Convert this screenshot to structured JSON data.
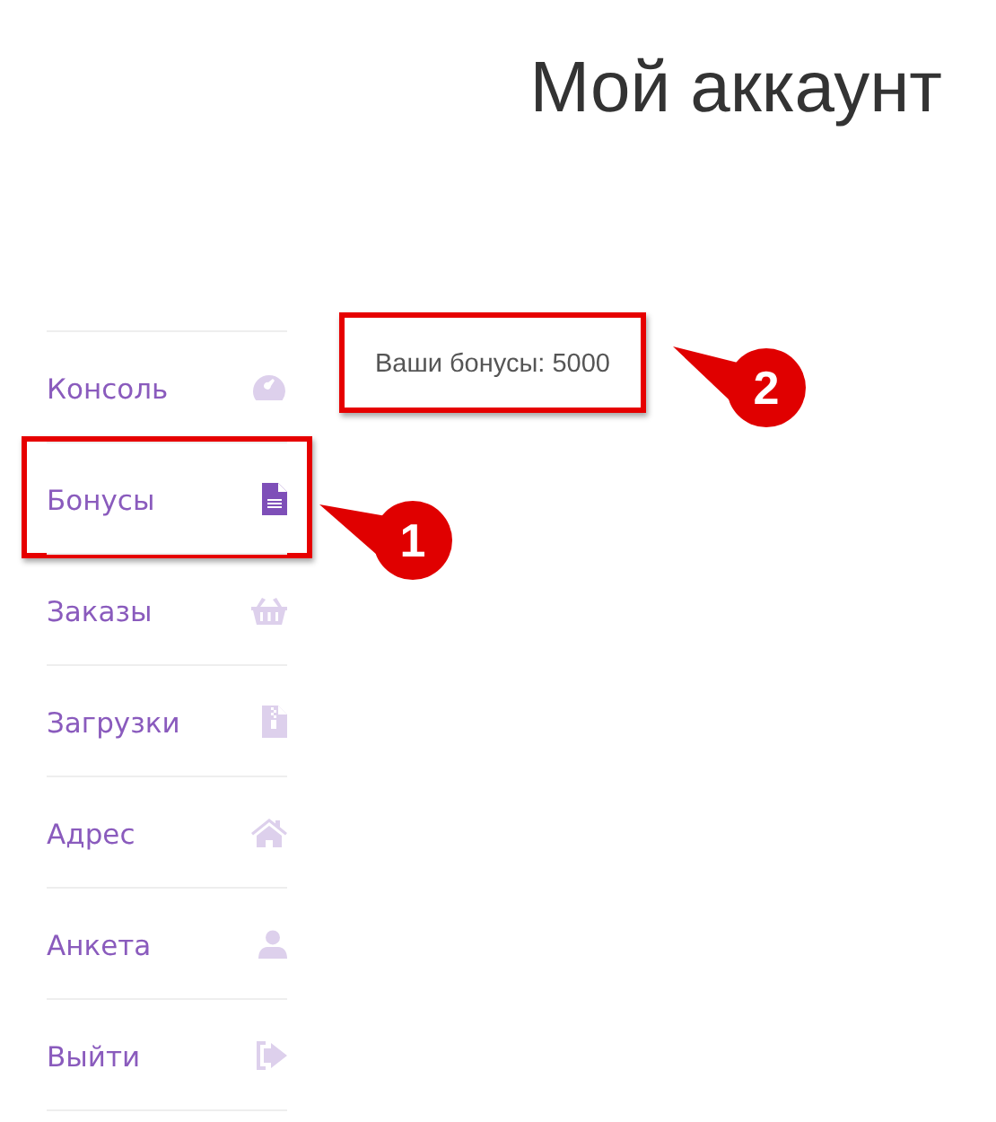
{
  "page_title": "Мой аккаунт",
  "sidebar": {
    "items": [
      {
        "label": "Консоль",
        "selected": false
      },
      {
        "label": "Бонусы",
        "selected": true,
        "callout": "1"
      },
      {
        "label": "Заказы",
        "selected": false
      },
      {
        "label": "Загрузки",
        "selected": false
      },
      {
        "label": "Адрес",
        "selected": false
      },
      {
        "label": "Анкета",
        "selected": false
      },
      {
        "label": "Выйти",
        "selected": false
      }
    ]
  },
  "content": {
    "text": "Ваши бонусы: 5000",
    "callout": "2"
  }
}
